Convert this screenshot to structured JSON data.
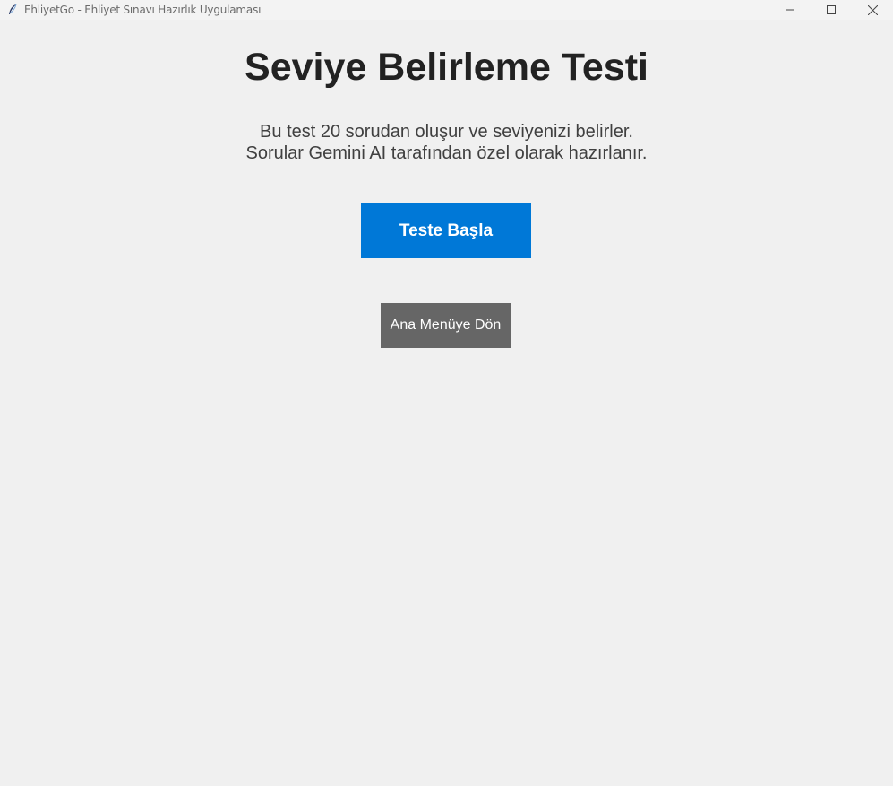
{
  "window": {
    "title": "EhliyetGo - Ehliyet Sınavı Hazırlık Uygulaması",
    "icon": "feather-icon",
    "controls": [
      "minimize-icon",
      "maximize-icon",
      "close-icon"
    ]
  },
  "main": {
    "title": "Seviye Belirleme Testi",
    "description_line1": "Bu test 20 sorudan oluşur ve seviyenizi belirler.",
    "description_line2": "Sorular Gemini AI tarafından özel olarak hazırlanır.",
    "start_button_label": "Teste Başla",
    "menu_button_label": "Ana Menüye Dön"
  },
  "colors": {
    "background": "#f0f0f0",
    "primary_button": "#0078d7",
    "secondary_button": "#666666",
    "title_text": "#222222"
  }
}
